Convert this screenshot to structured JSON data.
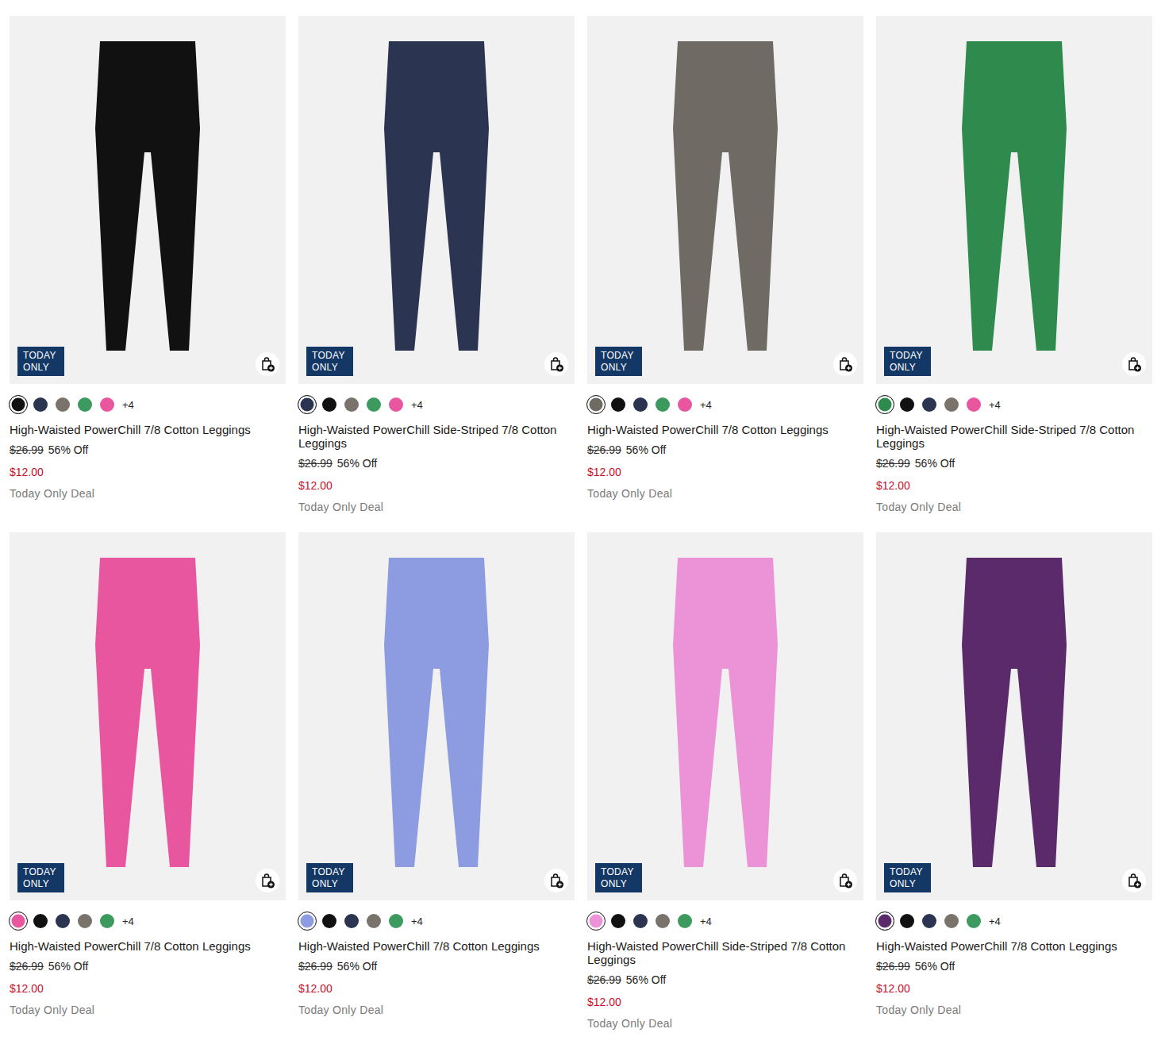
{
  "products": [
    {
      "title": "High-Waisted PowerChill 7/8 Cotton Leggings",
      "original_price": "$26.99",
      "discount": "56% Off",
      "price": "$12.00",
      "deal": "Today Only Deal",
      "badge": "TODAY ONLY",
      "more": "+4",
      "swatches": [
        {
          "color": "#111111",
          "selected": true
        },
        {
          "color": "#2b3450",
          "selected": false
        },
        {
          "color": "#7a736b",
          "selected": false
        },
        {
          "color": "#3d9a5f",
          "selected": false
        },
        {
          "color": "#e8569f",
          "selected": false
        }
      ]
    },
    {
      "title": "High-Waisted PowerChill Side-Striped 7/8 Cotton Leggings",
      "original_price": "$26.99",
      "discount": "56% Off",
      "price": "$12.00",
      "deal": "Today Only Deal",
      "badge": "TODAY ONLY",
      "more": "+4",
      "swatches": [
        {
          "color": "#2b3450",
          "selected": true
        },
        {
          "color": "#111111",
          "selected": false
        },
        {
          "color": "#7a736b",
          "selected": false
        },
        {
          "color": "#3d9a5f",
          "selected": false
        },
        {
          "color": "#e8569f",
          "selected": false
        }
      ]
    },
    {
      "title": "High-Waisted PowerChill 7/8 Cotton Leggings",
      "original_price": "$26.99",
      "discount": "56% Off",
      "price": "$12.00",
      "deal": "Today Only Deal",
      "badge": "TODAY ONLY",
      "more": "+4",
      "swatches": [
        {
          "color": "#6f6a64",
          "selected": true
        },
        {
          "color": "#111111",
          "selected": false
        },
        {
          "color": "#2b3450",
          "selected": false
        },
        {
          "color": "#3d9a5f",
          "selected": false
        },
        {
          "color": "#e8569f",
          "selected": false
        }
      ]
    },
    {
      "title": "High-Waisted PowerChill Side-Striped 7/8 Cotton Leggings",
      "original_price": "$26.99",
      "discount": "56% Off",
      "price": "$12.00",
      "deal": "Today Only Deal",
      "badge": "TODAY ONLY",
      "more": "+4",
      "swatches": [
        {
          "color": "#2f8a4e",
          "selected": true
        },
        {
          "color": "#111111",
          "selected": false
        },
        {
          "color": "#2b3450",
          "selected": false
        },
        {
          "color": "#7a736b",
          "selected": false
        },
        {
          "color": "#e8569f",
          "selected": false
        }
      ]
    },
    {
      "title": "High-Waisted PowerChill 7/8 Cotton Leggings",
      "original_price": "$26.99",
      "discount": "56% Off",
      "price": "$12.00",
      "deal": "Today Only Deal",
      "badge": "TODAY ONLY",
      "more": "+4",
      "swatches": [
        {
          "color": "#e8569f",
          "selected": true
        },
        {
          "color": "#111111",
          "selected": false
        },
        {
          "color": "#2b3450",
          "selected": false
        },
        {
          "color": "#7a736b",
          "selected": false
        },
        {
          "color": "#3d9a5f",
          "selected": false
        }
      ]
    },
    {
      "title": "High-Waisted PowerChill 7/8 Cotton Leggings",
      "original_price": "$26.99",
      "discount": "56% Off",
      "price": "$12.00",
      "deal": "Today Only Deal",
      "badge": "TODAY ONLY",
      "more": "+4",
      "swatches": [
        {
          "color": "#8d9ce0",
          "selected": true
        },
        {
          "color": "#111111",
          "selected": false
        },
        {
          "color": "#2b3450",
          "selected": false
        },
        {
          "color": "#7a736b",
          "selected": false
        },
        {
          "color": "#3d9a5f",
          "selected": false
        }
      ]
    },
    {
      "title": "High-Waisted PowerChill Side-Striped 7/8 Cotton Leggings",
      "original_price": "$26.99",
      "discount": "56% Off",
      "price": "$12.00",
      "deal": "Today Only Deal",
      "badge": "TODAY ONLY",
      "more": "+4",
      "swatches": [
        {
          "color": "#ec93d8",
          "selected": true
        },
        {
          "color": "#111111",
          "selected": false
        },
        {
          "color": "#2b3450",
          "selected": false
        },
        {
          "color": "#7a736b",
          "selected": false
        },
        {
          "color": "#3d9a5f",
          "selected": false
        }
      ]
    },
    {
      "title": "High-Waisted PowerChill 7/8 Cotton Leggings",
      "original_price": "$26.99",
      "discount": "56% Off",
      "price": "$12.00",
      "deal": "Today Only Deal",
      "badge": "TODAY ONLY",
      "more": "+4",
      "swatches": [
        {
          "color": "#5a2a6a",
          "selected": true
        },
        {
          "color": "#111111",
          "selected": false
        },
        {
          "color": "#2b3450",
          "selected": false
        },
        {
          "color": "#7a736b",
          "selected": false
        },
        {
          "color": "#3d9a5f",
          "selected": false
        }
      ]
    }
  ]
}
